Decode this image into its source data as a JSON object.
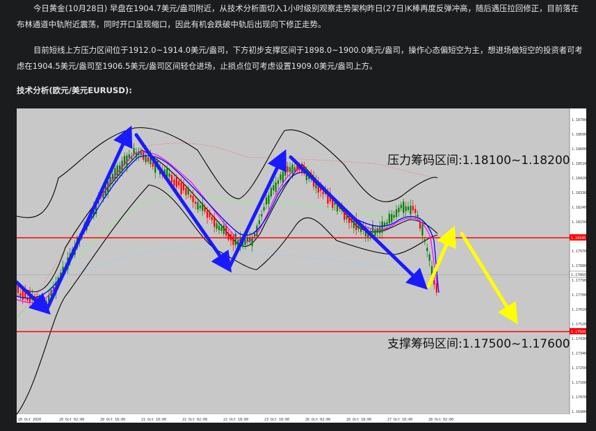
{
  "article": {
    "p1": "今日黄金(10月28日) 早盘在1904.7美元/盎司附近，从技术分析面切入1小时级别观察走势架构昨日(27日)K棒再度反弹冲高，随后遇压拉回修正，目前落在布林通道中轨附近震荡，同时开口呈现缩口，因此有机会跌破中轨后出现向下修正走势。",
    "p2": "目前短线上方压力区间位于1912.0~1914.0美元/盎司，下方初步支撑区间于1898.0~1900.0美元/盎司，操作心态偏短空为主，想进场做短空的投资者可考虑在1904.5美元/盎司至1906.5美元/盎司区间轻仓进场，止损点位可考虑设置1909.0美元/盎司上方。",
    "heading": "技术分析(欧元/美元EURUSD):"
  },
  "chart": {
    "resistance_label": "压力筹码区间:1.18100~1.18200",
    "support_label": "支撑筹码区间:1.17500~1.17600",
    "resistance_price_tag": "1.18100",
    "current_price_tag": "1.17860",
    "support_price_tag": "1.17500",
    "colors": {
      "background": "#c8c8c8",
      "resistance_line": "#ff0000",
      "support_line": "#ff0000",
      "arrow_blue": "#1a1aff",
      "arrow_yellow": "#ffff00",
      "bollinger": "#000000",
      "ma_fast": "#ff00ff",
      "ma_mid": "#0000ff",
      "ma_slow_green": "#90ee90",
      "ma_slow_blue": "#87cefa",
      "envelope": "#ff6666",
      "candle_up": "#008000",
      "candle_down": "#ff0000"
    },
    "y_ticks": [
      "1.18780",
      "1.18690",
      "1.18600",
      "1.18510",
      "1.18420",
      "1.18330",
      "1.18240",
      "1.18150",
      "1.18060",
      "1.17970",
      "1.17880",
      "1.17790",
      "1.17700",
      "1.17610",
      "1.17520",
      "1.17430",
      "1.17340",
      "1.17250",
      "1.17160",
      "1.17070",
      "1.16980"
    ],
    "x_ticks": [
      "20 Oct 2020",
      "20 Oct 02:00",
      "20 Oct 18:00",
      "21 Oct 10:00",
      "22 Oct 02:00",
      "22 Oct 18:00",
      "23 Oct 10:00",
      "26 Oct 02:00",
      "26 Oct 18:00",
      "27 Oct 10:00",
      "28 Oct 02:00"
    ]
  }
}
